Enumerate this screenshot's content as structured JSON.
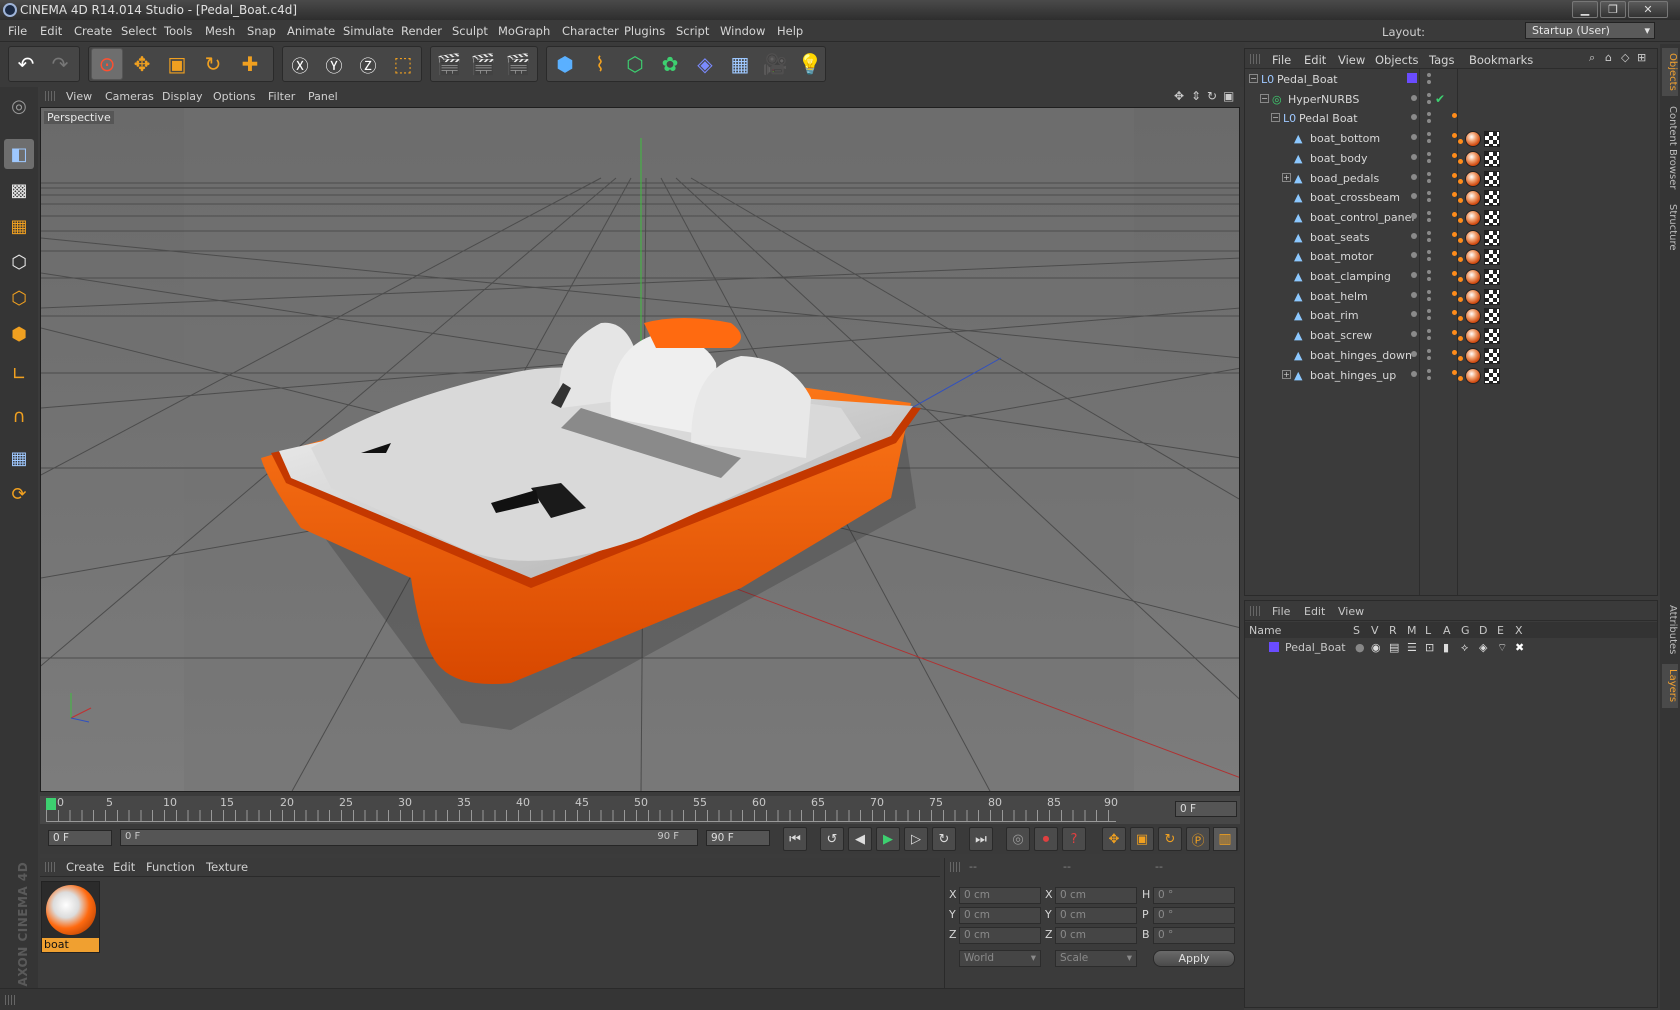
{
  "window": {
    "title": "CINEMA 4D R14.014 Studio - [Pedal_Boat.c4d]",
    "min": "▁",
    "max": "❐",
    "close": "✕"
  },
  "menu": [
    "File",
    "Edit",
    "Create",
    "Select",
    "Tools",
    "Mesh",
    "Snap",
    "Animate",
    "Simulate",
    "Render",
    "Sculpt",
    "MoGraph",
    "Character",
    "Plugins",
    "Script",
    "Window",
    "Help"
  ],
  "layout": {
    "label": "Layout:",
    "value": "Startup (User)"
  },
  "viewport": {
    "menu": [
      "View",
      "Cameras",
      "Display",
      "Options",
      "Filter",
      "Panel"
    ],
    "label": "Perspective"
  },
  "timeline": {
    "ticks": [
      "0",
      "5",
      "10",
      "15",
      "20",
      "25",
      "30",
      "35",
      "40",
      "45",
      "50",
      "55",
      "60",
      "65",
      "70",
      "75",
      "80",
      "85",
      "90"
    ],
    "current": "0 F",
    "start": "0 F",
    "range_start": "0 F",
    "range_end": "90 F",
    "end": "90 F"
  },
  "material_menu": [
    "Create",
    "Edit",
    "Function",
    "Texture"
  ],
  "material": {
    "name": "boat"
  },
  "coords": {
    "headers": [
      "--",
      "--",
      "--"
    ],
    "rows": [
      {
        "a": "X",
        "av": "0 cm",
        "b": "X",
        "bv": "0 cm",
        "c": "H",
        "cv": "0 °"
      },
      {
        "a": "Y",
        "av": "0 cm",
        "b": "Y",
        "bv": "0 cm",
        "c": "P",
        "cv": "0 °"
      },
      {
        "a": "Z",
        "av": "0 cm",
        "b": "Z",
        "bv": "0 cm",
        "c": "B",
        "cv": "0 °"
      }
    ],
    "mode1": "World",
    "mode2": "Scale",
    "apply": "Apply"
  },
  "objects": {
    "menu": [
      "File",
      "Edit",
      "View",
      "Objects",
      "Tags",
      "Bookmarks"
    ],
    "items": [
      {
        "name": "Pedal_Boat",
        "depth": 0,
        "type": "null"
      },
      {
        "name": "HyperNURBS",
        "depth": 1,
        "type": "nurbs"
      },
      {
        "name": "Pedal Boat",
        "depth": 2,
        "type": "null"
      },
      {
        "name": "boat_bottom",
        "depth": 3,
        "type": "poly"
      },
      {
        "name": "boat_body",
        "depth": 3,
        "type": "poly"
      },
      {
        "name": "boad_pedals",
        "depth": 3,
        "type": "poly"
      },
      {
        "name": "boat_crossbeam",
        "depth": 3,
        "type": "poly"
      },
      {
        "name": "boat_control_panel",
        "depth": 3,
        "type": "poly"
      },
      {
        "name": "boat_seats",
        "depth": 3,
        "type": "poly"
      },
      {
        "name": "boat_motor",
        "depth": 3,
        "type": "poly"
      },
      {
        "name": "boat_clamping",
        "depth": 3,
        "type": "poly"
      },
      {
        "name": "boat_helm",
        "depth": 3,
        "type": "poly"
      },
      {
        "name": "boat_rim",
        "depth": 3,
        "type": "poly"
      },
      {
        "name": "boat_screw",
        "depth": 3,
        "type": "poly"
      },
      {
        "name": "boat_hinges_down",
        "depth": 3,
        "type": "poly"
      },
      {
        "name": "boat_hinges_up",
        "depth": 3,
        "type": "poly"
      }
    ]
  },
  "layers": {
    "menu": [
      "File",
      "Edit",
      "View"
    ],
    "columns": [
      "Name",
      "S",
      "V",
      "R",
      "M",
      "L",
      "A",
      "G",
      "D",
      "E",
      "X"
    ],
    "rows": [
      {
        "name": "Pedal_Boat",
        "color": "#6a4cff"
      }
    ]
  },
  "right_tabs": [
    "Objects",
    "Content Browser",
    "Structure",
    "Attributes",
    "Layers"
  ],
  "brand": "MAXON CINEMA 4D",
  "colors": {
    "accent": "#f0a030",
    "boat_orange": "#ff6a10",
    "layer_purple": "#6a4cff"
  }
}
